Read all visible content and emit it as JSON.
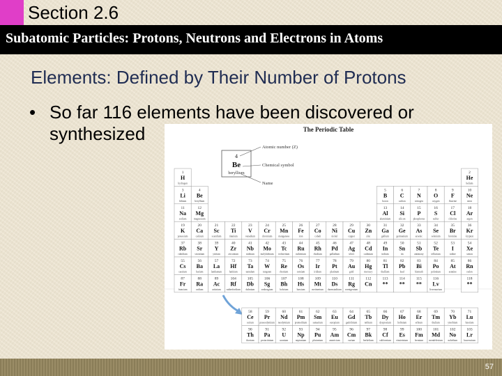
{
  "section_title": "Section 2.6",
  "subtitle": "Subatomic Particles: Protons, Neutrons and Electrons in Atoms",
  "heading": "Elements:  Defined by Their Number of Protons",
  "bullet_symbol": "•",
  "bullet_text_line1": "So far 116 elements have been discovered or",
  "bullet_text_line2": "synthesized",
  "periodic_table": {
    "title": "The Periodic Table",
    "key": {
      "atomic_number": "4",
      "symbol": "Be",
      "name": "beryllium",
      "label_atomic_number": "Atomic number (Z)",
      "label_symbol": "Chemical symbol",
      "label_name": "Name"
    },
    "elements": [
      {
        "num": "1",
        "sym": "H",
        "name": "hydrogen"
      },
      {
        "num": "2",
        "sym": "He",
        "name": "helium"
      },
      {
        "num": "3",
        "sym": "Li",
        "name": "lithium"
      },
      {
        "num": "4",
        "sym": "Be",
        "name": "beryllium"
      },
      {
        "num": "5",
        "sym": "B",
        "name": "boron"
      },
      {
        "num": "6",
        "sym": "C",
        "name": "carbon"
      },
      {
        "num": "7",
        "sym": "N",
        "name": "nitrogen"
      },
      {
        "num": "8",
        "sym": "O",
        "name": "oxygen"
      },
      {
        "num": "9",
        "sym": "F",
        "name": "fluorine"
      },
      {
        "num": "10",
        "sym": "Ne",
        "name": "neon"
      },
      {
        "num": "11",
        "sym": "Na",
        "name": "sodium"
      },
      {
        "num": "12",
        "sym": "Mg",
        "name": "magnesium"
      },
      {
        "num": "13",
        "sym": "Al",
        "name": "aluminium"
      },
      {
        "num": "14",
        "sym": "Si",
        "name": "silicon"
      },
      {
        "num": "15",
        "sym": "P",
        "name": "phosphorus"
      },
      {
        "num": "16",
        "sym": "S",
        "name": "sulfur"
      },
      {
        "num": "17",
        "sym": "Cl",
        "name": "chlorine"
      },
      {
        "num": "18",
        "sym": "Ar",
        "name": "argon"
      },
      {
        "num": "19",
        "sym": "K",
        "name": "potassium"
      },
      {
        "num": "20",
        "sym": "Ca",
        "name": "calcium"
      },
      {
        "num": "21",
        "sym": "Sc",
        "name": "scandium"
      },
      {
        "num": "22",
        "sym": "Ti",
        "name": "titanium"
      },
      {
        "num": "23",
        "sym": "V",
        "name": "vanadium"
      },
      {
        "num": "24",
        "sym": "Cr",
        "name": "chromium"
      },
      {
        "num": "25",
        "sym": "Mn",
        "name": "manganese"
      },
      {
        "num": "26",
        "sym": "Fe",
        "name": "iron"
      },
      {
        "num": "27",
        "sym": "Co",
        "name": "cobalt"
      },
      {
        "num": "28",
        "sym": "Ni",
        "name": "nickel"
      },
      {
        "num": "29",
        "sym": "Cu",
        "name": "copper"
      },
      {
        "num": "30",
        "sym": "Zn",
        "name": "zinc"
      },
      {
        "num": "31",
        "sym": "Ga",
        "name": "gallium"
      },
      {
        "num": "32",
        "sym": "Ge",
        "name": "germanium"
      },
      {
        "num": "33",
        "sym": "As",
        "name": "arsenic"
      },
      {
        "num": "34",
        "sym": "Se",
        "name": "selenium"
      },
      {
        "num": "35",
        "sym": "Br",
        "name": "bromine"
      },
      {
        "num": "36",
        "sym": "Kr",
        "name": "krypton"
      },
      {
        "num": "37",
        "sym": "Rb",
        "name": "rubidium"
      },
      {
        "num": "38",
        "sym": "Sr",
        "name": "strontium"
      },
      {
        "num": "39",
        "sym": "Y",
        "name": "yttrium"
      },
      {
        "num": "40",
        "sym": "Zr",
        "name": "zirconium"
      },
      {
        "num": "41",
        "sym": "Nb",
        "name": "niobium"
      },
      {
        "num": "42",
        "sym": "Mo",
        "name": "molybdenum"
      },
      {
        "num": "43",
        "sym": "Tc",
        "name": "technetium"
      },
      {
        "num": "44",
        "sym": "Ru",
        "name": "ruthenium"
      },
      {
        "num": "45",
        "sym": "Rh",
        "name": "rhodium"
      },
      {
        "num": "46",
        "sym": "Pd",
        "name": "palladium"
      },
      {
        "num": "47",
        "sym": "Ag",
        "name": "silver"
      },
      {
        "num": "48",
        "sym": "Cd",
        "name": "cadmium"
      },
      {
        "num": "49",
        "sym": "In",
        "name": "indium"
      },
      {
        "num": "50",
        "sym": "Sn",
        "name": "tin"
      },
      {
        "num": "51",
        "sym": "Sb",
        "name": "antimony"
      },
      {
        "num": "52",
        "sym": "Te",
        "name": "tellurium"
      },
      {
        "num": "53",
        "sym": "I",
        "name": "iodine"
      },
      {
        "num": "54",
        "sym": "Xe",
        "name": "xenon"
      },
      {
        "num": "55",
        "sym": "Cs",
        "name": "caesium"
      },
      {
        "num": "56",
        "sym": "Ba",
        "name": "barium"
      },
      {
        "num": "57",
        "sym": "La",
        "name": "lanthanum"
      },
      {
        "num": "72",
        "sym": "Hf",
        "name": "hafnium"
      },
      {
        "num": "73",
        "sym": "Ta",
        "name": "tantalum"
      },
      {
        "num": "74",
        "sym": "W",
        "name": "tungsten"
      },
      {
        "num": "75",
        "sym": "Re",
        "name": "rhenium"
      },
      {
        "num": "76",
        "sym": "Os",
        "name": "osmium"
      },
      {
        "num": "77",
        "sym": "Ir",
        "name": "iridium"
      },
      {
        "num": "78",
        "sym": "Pt",
        "name": "platinum"
      },
      {
        "num": "79",
        "sym": "Au",
        "name": "gold"
      },
      {
        "num": "80",
        "sym": "Hg",
        "name": "mercury"
      },
      {
        "num": "81",
        "sym": "Tl",
        "name": "thallium"
      },
      {
        "num": "82",
        "sym": "Pb",
        "name": "lead"
      },
      {
        "num": "83",
        "sym": "Bi",
        "name": "bismuth"
      },
      {
        "num": "84",
        "sym": "Po",
        "name": "polonium"
      },
      {
        "num": "85",
        "sym": "At",
        "name": "astatine"
      },
      {
        "num": "86",
        "sym": "Rn",
        "name": "radon"
      },
      {
        "num": "87",
        "sym": "Fr",
        "name": "francium"
      },
      {
        "num": "88",
        "sym": "Ra",
        "name": "radium"
      },
      {
        "num": "89",
        "sym": "Ac",
        "name": "actinium"
      },
      {
        "num": "104",
        "sym": "Rf",
        "name": "rutherfordium"
      },
      {
        "num": "105",
        "sym": "Db",
        "name": "dubnium"
      },
      {
        "num": "106",
        "sym": "Sg",
        "name": "seaborgium"
      },
      {
        "num": "107",
        "sym": "Bh",
        "name": "bohrium"
      },
      {
        "num": "108",
        "sym": "Hs",
        "name": "hassium"
      },
      {
        "num": "109",
        "sym": "Mt",
        "name": "meitnerium"
      },
      {
        "num": "110",
        "sym": "Ds",
        "name": "darmstadtium"
      },
      {
        "num": "111",
        "sym": "Rg",
        "name": "roentgenium"
      },
      {
        "num": "112",
        "sym": "Cn",
        "name": ""
      },
      {
        "num": "113",
        "sym": "**",
        "name": ""
      },
      {
        "num": "114",
        "sym": "**",
        "name": ""
      },
      {
        "num": "115",
        "sym": "**",
        "name": ""
      },
      {
        "num": "116",
        "sym": "Lv",
        "name": "livermorium"
      },
      {
        "num": "118",
        "sym": "**",
        "name": ""
      },
      {
        "num": "58",
        "sym": "Ce",
        "name": "cerium"
      },
      {
        "num": "59",
        "sym": "Pr",
        "name": "praseodymium"
      },
      {
        "num": "60",
        "sym": "Nd",
        "name": "neodymium"
      },
      {
        "num": "61",
        "sym": "Pm",
        "name": "promethium"
      },
      {
        "num": "62",
        "sym": "Sm",
        "name": "samarium"
      },
      {
        "num": "63",
        "sym": "Eu",
        "name": "europium"
      },
      {
        "num": "64",
        "sym": "Gd",
        "name": "gadolinium"
      },
      {
        "num": "65",
        "sym": "Tb",
        "name": "terbium"
      },
      {
        "num": "66",
        "sym": "Dy",
        "name": "dysprosium"
      },
      {
        "num": "67",
        "sym": "Ho",
        "name": "holmium"
      },
      {
        "num": "68",
        "sym": "Er",
        "name": "erbium"
      },
      {
        "num": "69",
        "sym": "Tm",
        "name": "thulium"
      },
      {
        "num": "70",
        "sym": "Yb",
        "name": "ytterbium"
      },
      {
        "num": "71",
        "sym": "Lu",
        "name": "lutetium"
      },
      {
        "num": "90",
        "sym": "Th",
        "name": "thorium"
      },
      {
        "num": "91",
        "sym": "Pa",
        "name": "protactinium"
      },
      {
        "num": "92",
        "sym": "U",
        "name": "uranium"
      },
      {
        "num": "93",
        "sym": "Np",
        "name": "neptunium"
      },
      {
        "num": "94",
        "sym": "Pu",
        "name": "plutonium"
      },
      {
        "num": "95",
        "sym": "Am",
        "name": "americium"
      },
      {
        "num": "96",
        "sym": "Cm",
        "name": "curium"
      },
      {
        "num": "97",
        "sym": "Bk",
        "name": "berkelium"
      },
      {
        "num": "98",
        "sym": "Cf",
        "name": "californium"
      },
      {
        "num": "99",
        "sym": "Es",
        "name": "einsteinium"
      },
      {
        "num": "100",
        "sym": "Fm",
        "name": "fermium"
      },
      {
        "num": "101",
        "sym": "Md",
        "name": "mendelevium"
      },
      {
        "num": "102",
        "sym": "No",
        "name": "nobelium"
      },
      {
        "num": "103",
        "sym": "Lr",
        "name": "lawrencium"
      }
    ]
  },
  "page_number": "57",
  "colors": {
    "accent_tab": "#e03ec8",
    "subtitle_bar": "#000000",
    "heading_text": "#1f2c52",
    "footer_bar": "#8a7d58",
    "arrow": "#6fa3d8"
  }
}
